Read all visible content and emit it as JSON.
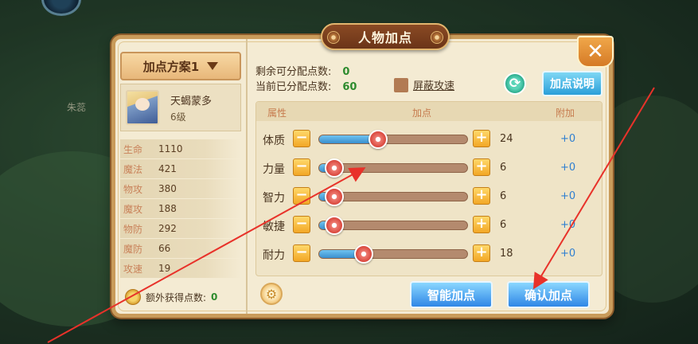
{
  "window": {
    "title": "人物加点",
    "close_icon": "close-x-icon"
  },
  "background": {
    "character_label": "朱蕊"
  },
  "left_panel": {
    "scheme_label": "加点方案1",
    "hero": {
      "name": "天蝎蒙多",
      "level": "6级"
    },
    "stats": [
      {
        "name": "生命",
        "value": "1110"
      },
      {
        "name": "魔法",
        "value": "421"
      },
      {
        "name": "物攻",
        "value": "380"
      },
      {
        "name": "魔攻",
        "value": "188"
      },
      {
        "name": "物防",
        "value": "292"
      },
      {
        "name": "魔防",
        "value": "66"
      },
      {
        "name": "攻速",
        "value": "19"
      }
    ],
    "extra_label": "额外获得点数:",
    "extra_value": "0"
  },
  "info": {
    "remaining_label": "剩余可分配点数:",
    "remaining_value": "0",
    "allocated_label": "当前已分配点数:",
    "allocated_value": "60",
    "shield_label": "屏蔽攻速",
    "help_label": "加点说明"
  },
  "table": {
    "headers": {
      "attr": "属性",
      "points": "加点",
      "bonus": "附加"
    },
    "rows": [
      {
        "attr": "体质",
        "value": "24",
        "bonus": "+0",
        "level": 0.4
      },
      {
        "attr": "力量",
        "value": "6",
        "bonus": "+0",
        "level": 0.1
      },
      {
        "attr": "智力",
        "value": "6",
        "bonus": "+0",
        "level": 0.1
      },
      {
        "attr": "敏捷",
        "value": "6",
        "bonus": "+0",
        "level": 0.1
      },
      {
        "attr": "耐力",
        "value": "18",
        "bonus": "+0",
        "level": 0.3
      }
    ],
    "minus": "−",
    "plus": "+"
  },
  "actions": {
    "auto_label": "智能加点",
    "confirm_label": "确认加点"
  },
  "colors": {
    "annotation": "#e8322a",
    "accent_blue": "#2f86e6",
    "panel": "#f4ebd3"
  }
}
